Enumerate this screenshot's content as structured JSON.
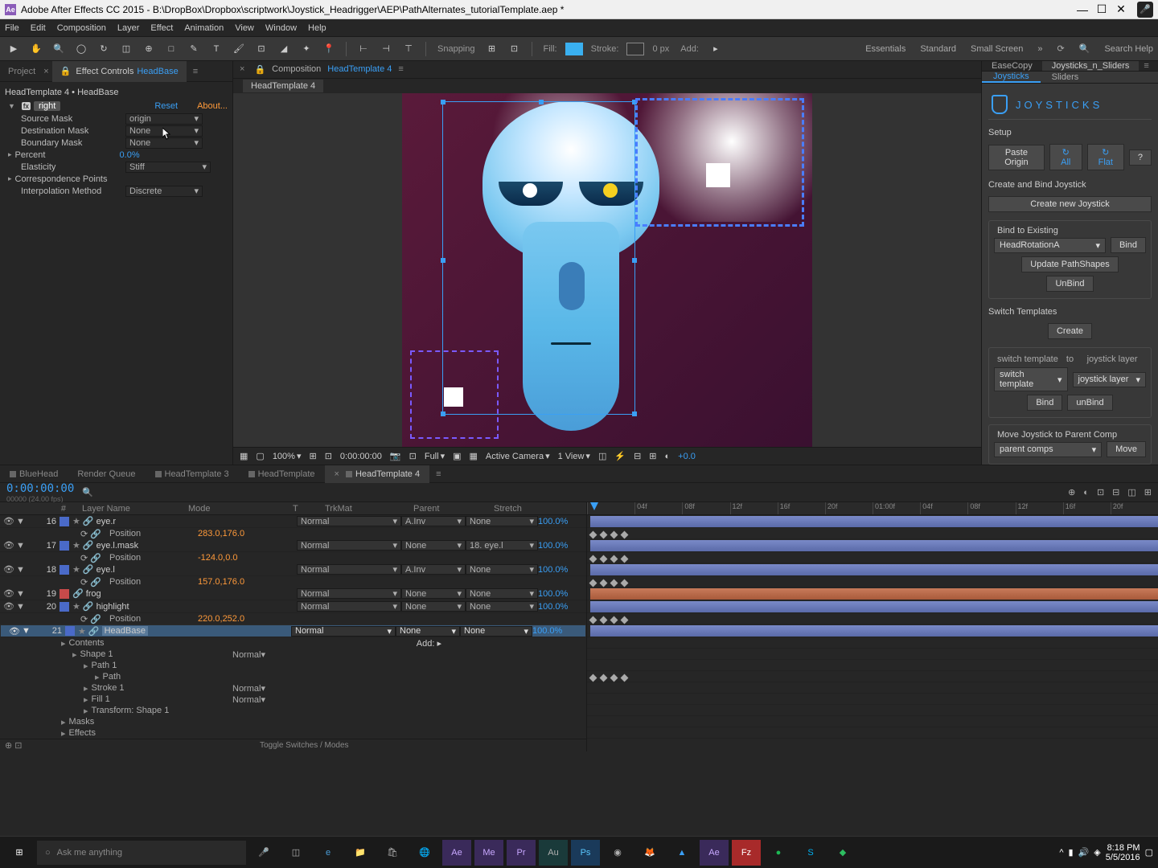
{
  "app": {
    "title": "Adobe After Effects CC 2015 - B:\\DropBox\\Dropbox\\scriptwork\\Joystick_Headrigger\\AEP\\PathAlternates_tutorialTemplate.aep *",
    "icon_text": "Ae"
  },
  "menu": [
    "File",
    "Edit",
    "Composition",
    "Layer",
    "Effect",
    "Animation",
    "View",
    "Window",
    "Help"
  ],
  "toolbar": {
    "snapping": "Snapping",
    "fill_label": "Fill:",
    "fill_color": "#3ab0f0",
    "stroke_label": "Stroke:",
    "stroke_px": "0 px",
    "add_label": "Add:",
    "workspaces": [
      "Essentials",
      "Standard",
      "Small Screen"
    ],
    "search_placeholder": "Search Help"
  },
  "project_tab": "Project",
  "effect_controls": {
    "tab_label": "Effect Controls",
    "tab_layer": "HeadBase",
    "breadcrumb": "HeadTemplate 4 • HeadBase",
    "fx_name": "right",
    "reset": "Reset",
    "about": "About...",
    "props": {
      "source_mask": {
        "label": "Source Mask",
        "value": "origin"
      },
      "dest_mask": {
        "label": "Destination Mask",
        "value": "None"
      },
      "boundary_mask": {
        "label": "Boundary Mask",
        "value": "None"
      },
      "percent": {
        "label": "Percent",
        "value": "0.0%"
      },
      "elasticity": {
        "label": "Elasticity",
        "value": "Stiff"
      },
      "corr_points": {
        "label": "Correspondence Points"
      },
      "interp": {
        "label": "Interpolation Method",
        "value": "Discrete"
      }
    }
  },
  "composition": {
    "tab_label": "Composition",
    "tab_comp": "HeadTemplate 4",
    "nested": "HeadTemplate 4"
  },
  "viewer_bar": {
    "zoom": "100%",
    "timecode": "0:00:00:00",
    "resolution": "Full",
    "camera": "Active Camera",
    "views": "1 View",
    "exposure": "+0.0"
  },
  "right_panel": {
    "tabs": {
      "easecopy": "EaseCopy",
      "jns": "Joysticks_n_Sliders"
    },
    "subtabs": {
      "joysticks": "Joysticks",
      "sliders": "Sliders"
    },
    "logo": "JOYSTICKS",
    "setup": "Setup",
    "paste_origin": "Paste Origin",
    "all": "All",
    "flat": "Flat",
    "help": "?",
    "create_bind": "Create and Bind Joystick",
    "create_new": "Create new Joystick",
    "bind_existing": "Bind to Existing",
    "head_rotation": "HeadRotationA",
    "bind": "Bind",
    "update_paths": "Update PathShapes",
    "unbind": "UnBind",
    "switch_templates": "Switch Templates",
    "create": "Create",
    "switch_template_lbl": "switch template",
    "joystick_layer_lbl": "joystick layer",
    "to": "to",
    "switch_template_sel": "switch template",
    "joystick_layer_sel": "joystick layer",
    "bind2": "Bind",
    "unbind2": "unBind",
    "move_joystick": "Move Joystick to Parent Comp",
    "parent_comps": "parent comps",
    "move": "Move"
  },
  "timeline": {
    "tabs": [
      "BlueHead",
      "Render Queue",
      "HeadTemplate 3",
      "HeadTemplate",
      "HeadTemplate 4"
    ],
    "active_tab": 4,
    "time": "0:00:00:00",
    "fps": "00000 (24.00 fps)",
    "cols": {
      "num": "#",
      "layer_name": "Layer Name",
      "mode": "Mode",
      "t": "T",
      "trkmat": "TrkMat",
      "parent": "Parent",
      "stretch": "Stretch"
    },
    "ruler": [
      "",
      "04f",
      "08f",
      "12f",
      "16f",
      "20f",
      "01:00f",
      "04f",
      "08f",
      "12f",
      "16f",
      "20f"
    ],
    "layers": [
      {
        "idx": 16,
        "color": "#4a6ac8",
        "name": "eye.r",
        "star": true,
        "mode": "Normal",
        "trkmat": "A.Inv",
        "parent": "None",
        "stretch": "100.0%",
        "position": "283.0,176.0",
        "bar": "blue"
      },
      {
        "idx": 17,
        "color": "#4a6ac8",
        "name": "eye.l.mask",
        "star": true,
        "mode": "Normal",
        "trkmat": "None",
        "parent": "18. eye.l",
        "stretch": "100.0%",
        "position": "-124.0,0.0",
        "bar": "blue"
      },
      {
        "idx": 18,
        "color": "#4a6ac8",
        "name": "eye.l",
        "star": true,
        "mode": "Normal",
        "trkmat": "A.Inv",
        "parent": "None",
        "stretch": "100.0%",
        "position": "157.0,176.0",
        "bar": "blue"
      },
      {
        "idx": 19,
        "color": "#c84a4a",
        "name": "frog",
        "star": false,
        "mode": "Normal",
        "trkmat": "None",
        "parent": "None",
        "stretch": "100.0%",
        "bar": "red"
      },
      {
        "idx": 20,
        "color": "#4a6ac8",
        "name": "highlight",
        "star": true,
        "mode": "Normal",
        "trkmat": "None",
        "parent": "None",
        "stretch": "100.0%",
        "position": "220.0,252.0",
        "bar": "blue"
      },
      {
        "idx": 21,
        "color": "#4a6ac8",
        "name": "HeadBase",
        "star": true,
        "selected": true,
        "mode": "Normal",
        "trkmat": "None",
        "parent": "None",
        "stretch": "100.0%",
        "bar": "blue"
      }
    ],
    "sublayers": {
      "contents": "Contents",
      "add": "Add:",
      "shape1": "Shape 1",
      "path1": "Path 1",
      "path": "Path",
      "stroke1": "Stroke 1",
      "fill1": "Fill 1",
      "transform_shape": "Transform: Shape 1",
      "masks": "Masks",
      "effects": "Effects",
      "normal": "Normal"
    },
    "toggle": "Toggle Switches / Modes"
  },
  "taskbar": {
    "search": "Ask me anything",
    "time": "8:18 PM",
    "date": "5/5/2016"
  }
}
